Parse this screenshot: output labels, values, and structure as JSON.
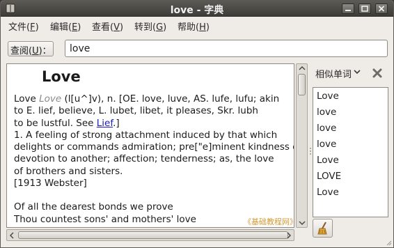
{
  "window": {
    "title": "love - 字典"
  },
  "menu": [
    {
      "label": "文件(",
      "key": "F",
      "suffix": ")"
    },
    {
      "label": "编辑(",
      "key": "E",
      "suffix": ")"
    },
    {
      "label": "查看(",
      "key": "V",
      "suffix": ")"
    },
    {
      "label": "转到(",
      "key": "G",
      "suffix": ")"
    },
    {
      "label": "帮助(",
      "key": "H",
      "suffix": ")"
    }
  ],
  "search": {
    "label_prefix": "查阅(",
    "label_key": "U",
    "label_suffix": ")：",
    "value": "love"
  },
  "definition": {
    "headword": "Love",
    "entry_word": "Love",
    "entry_italic": "Love",
    "entry_rest": " (l[u^]v), n. [OE. love, luve, AS. lufe, lufu; akin",
    "line2": " to E. lief, believe, L. lubet, libet, it pleases, Skr. lubh",
    "line3_prefix": " to be lustful. See ",
    "line3_link": "Lief",
    "line3_suffix": ".]",
    "line4": "1. A feeling of strong attachment induced by that which",
    "line5": "delights or commands admiration; pre[\"e]minent kindness or",
    "line6": "devotion to another; affection; tenderness; as, the love",
    "line7": "of brothers and sisters.",
    "line8": "[1913 Webster]",
    "line9": "Of all the dearest bonds we prove",
    "line10": "Thou countest sons' and mothers' love"
  },
  "watermark": "《基础教程网》",
  "similar": {
    "header": "相似单词",
    "items": [
      "Love",
      "love",
      "love",
      "love",
      "Love",
      "LOVE",
      "Love"
    ]
  },
  "colors": {
    "link": "#1919c8",
    "watermark": "#d49a33",
    "titlebar": "#4a4945"
  }
}
